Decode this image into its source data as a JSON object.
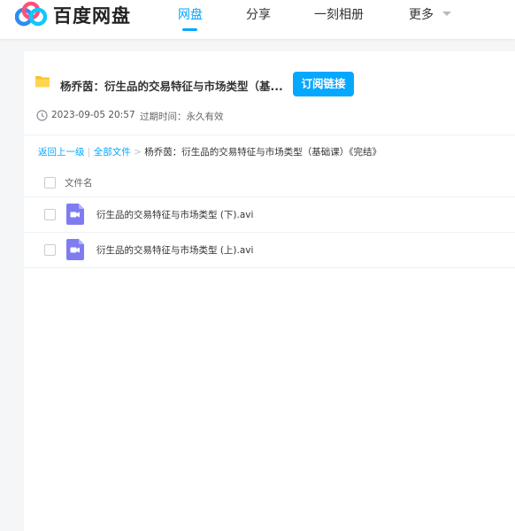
{
  "brand": {
    "name": "百度网盘"
  },
  "nav": {
    "items": [
      {
        "label": "网盘",
        "active": true
      },
      {
        "label": "分享",
        "active": false
      },
      {
        "label": "一刻相册",
        "active": false
      },
      {
        "label": "更多",
        "active": false
      }
    ],
    "accent_color": "#06a7ff"
  },
  "share": {
    "title": "杨乔茵：衍生品的交易特征与市场类型（基...",
    "subscribe_label": "订阅链接",
    "date": "2023-09-05 20:57",
    "expire": "过期时间：永久有效"
  },
  "breadcrumb": {
    "back": "返回上一级",
    "sep1": "|",
    "all_files": "全部文件",
    "sep2": ">",
    "current": "杨乔茵：衍生品的交易特征与市场类型（基础课）《完结》"
  },
  "file_list": {
    "column_name": "文件名",
    "files": [
      {
        "name": "衍生品的交易特征与市场类型 (下).avi",
        "icon": "video-file-icon"
      },
      {
        "name": "衍生品的交易特征与市场类型 (上).avi",
        "icon": "video-file-icon"
      }
    ]
  }
}
